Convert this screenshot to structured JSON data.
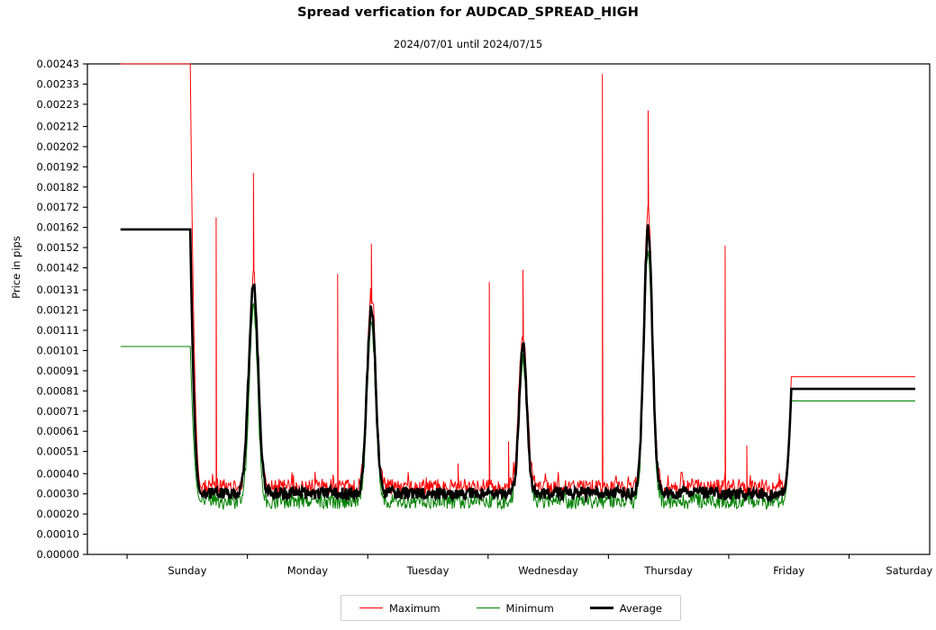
{
  "chart_data": {
    "type": "line",
    "title": "Spread verfication for AUDCAD_SPREAD_HIGH",
    "subtitle": "2024/07/01 until 2024/07/15",
    "xlabel": "",
    "ylabel": "Price in pips",
    "grid": false,
    "legend_position": "bottom-center",
    "xlim": [
      0,
      7
    ],
    "ylim": [
      0.0,
      0.00243
    ],
    "x_tick_labels": [
      "Sunday",
      "Monday",
      "Tuesday",
      "Wednesday",
      "Thursday",
      "Friday",
      "Saturday"
    ],
    "x_tick_positions": [
      0.5,
      1.5,
      2.5,
      3.5,
      4.5,
      5.5,
      6.5
    ],
    "x_boundaries": [
      0.33,
      1.33,
      2.33,
      3.33,
      4.33,
      5.33,
      6.33,
      7.33
    ],
    "y_tick_labels": [
      "0.00000",
      "0.00010",
      "0.00020",
      "0.00030",
      "0.00040",
      "0.00051",
      "0.00061",
      "0.00071",
      "0.00081",
      "0.00091",
      "0.00101",
      "0.00111",
      "0.00121",
      "0.00131",
      "0.00142",
      "0.00152",
      "0.00162",
      "0.00172",
      "0.00182",
      "0.00192",
      "0.00202",
      "0.00212",
      "0.00223",
      "0.00233",
      "0.00243"
    ],
    "y_tick_values": [
      0.0,
      0.0001,
      0.0002,
      0.0003,
      0.0004,
      0.00051,
      0.00061,
      0.00071,
      0.00081,
      0.00091,
      0.00101,
      0.00111,
      0.00121,
      0.00131,
      0.00142,
      0.00152,
      0.00162,
      0.00172,
      0.00182,
      0.00192,
      0.00202,
      0.00212,
      0.00223,
      0.00233,
      0.00243
    ],
    "series": [
      {
        "name": "Maximum",
        "color": "#ff0000",
        "width": 1.0,
        "weekend_start_level": 0.00243,
        "weekend_end_level": 0.00088,
        "baseline_level": 0.00033,
        "baseline_noise": 4e-05,
        "spikes": [
          {
            "x": 1.07,
            "y": 0.00167
          },
          {
            "x": 1.38,
            "y": 0.00189
          },
          {
            "x": 2.08,
            "y": 0.00139
          },
          {
            "x": 2.36,
            "y": 0.00154
          },
          {
            "x": 3.08,
            "y": 0.00045
          },
          {
            "x": 3.34,
            "y": 0.00135
          },
          {
            "x": 3.5,
            "y": 0.00056
          },
          {
            "x": 3.62,
            "y": 0.00141
          },
          {
            "x": 4.28,
            "y": 0.00238
          },
          {
            "x": 4.66,
            "y": 0.0022
          },
          {
            "x": 5.3,
            "y": 0.00153
          },
          {
            "x": 5.48,
            "y": 0.00054
          }
        ]
      },
      {
        "name": "Minimum",
        "color": "#008000",
        "width": 1.0,
        "weekend_start_level": 0.00103,
        "weekend_end_level": 0.00076,
        "baseline_level": 0.00026,
        "baseline_noise": 4e-05,
        "spikes": []
      },
      {
        "name": "Average",
        "color": "#000000",
        "width": 2.6,
        "weekend_start_level": 0.00161,
        "weekend_end_level": 0.00082,
        "baseline_level": 0.0003,
        "baseline_noise": 3e-05,
        "peaks": [
          {
            "x": 1.38,
            "y": 0.00133,
            "width": 0.055
          },
          {
            "x": 2.36,
            "y": 0.00122,
            "width": 0.05
          },
          {
            "x": 3.62,
            "y": 0.00103,
            "width": 0.045
          },
          {
            "x": 4.66,
            "y": 0.00161,
            "width": 0.05
          }
        ]
      }
    ]
  },
  "legend": {
    "items": [
      {
        "label": "Maximum",
        "color": "#ff0000",
        "thickness": "1.3px"
      },
      {
        "label": "Minimum",
        "color": "#008000",
        "thickness": "1.3px"
      },
      {
        "label": "Average",
        "color": "#000000",
        "thickness": "3px"
      }
    ]
  }
}
